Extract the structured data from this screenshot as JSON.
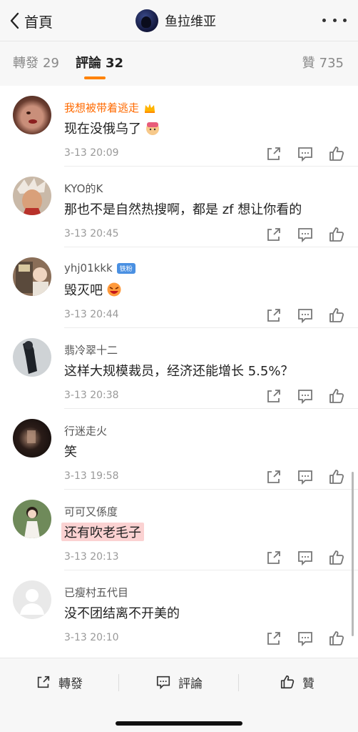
{
  "header": {
    "back_label": "首頁",
    "title": "鱼拉维亚"
  },
  "tabs": [
    {
      "label": "轉發",
      "count": "29"
    },
    {
      "label": "評論",
      "count": "32"
    },
    {
      "label": "贊",
      "count": "735"
    }
  ],
  "comments": [
    {
      "name": "我想被带着逃走",
      "text": "现在没俄乌了",
      "time": "3-13 20:09"
    },
    {
      "name": "KYO的K",
      "text": "那也不是自然热搜啊，都是 zf 想让你看的",
      "time": "3-13 20:45"
    },
    {
      "name": "yhj01kkk",
      "badge": "铁粉",
      "text": "毁灭吧",
      "time": "3-13 20:44"
    },
    {
      "name": "翡冷翠十二",
      "text": "这样大规模裁员，经济还能增长 5.5%？",
      "time": "3-13 20:38"
    },
    {
      "name": "行迷走火",
      "text": "笑",
      "time": "3-13 19:58"
    },
    {
      "name": "可可又係度",
      "text": "还有吹老毛子",
      "time": "3-13 20:13"
    },
    {
      "name": "已瘦村五代目",
      "text": "没不团结离不开美的",
      "time": "3-13 20:10"
    }
  ],
  "bottom": {
    "repost": "轉發",
    "comment": "評論",
    "like": "贊"
  },
  "colors": {
    "accent": "#ff8200",
    "username_orange": "#ff6a00",
    "highlight": "#fbd2d2"
  }
}
